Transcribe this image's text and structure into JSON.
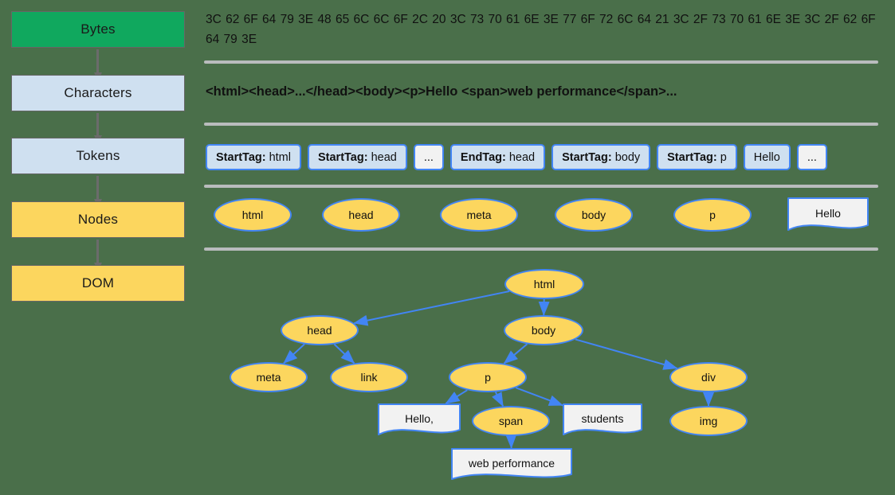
{
  "colors": {
    "background": "#4a6f4a",
    "green": "#10a85e",
    "light_blue": "#cfe0f0",
    "yellow": "#fcd65e",
    "node_border_blue": "#4285f4",
    "arrow_gray": "#6b6b6b",
    "separator_gray": "#b9bcbd",
    "text_node_gray": "#f2f2f2"
  },
  "pipeline": {
    "stages": [
      {
        "label": "Bytes",
        "style": "green"
      },
      {
        "label": "Characters",
        "style": "blue"
      },
      {
        "label": "Tokens",
        "style": "blue"
      },
      {
        "label": "Nodes",
        "style": "yellow"
      },
      {
        "label": "DOM",
        "style": "yellow"
      }
    ]
  },
  "bytes_row": {
    "text": "3C 62 6F 64 79 3E 48 65 6C 6C 6F 2C 20 3C 73 70 61 6E 3E 77 6F 72 6C 64 21 3C 2F 73 70 61 6E 3E 3C 2F 62 6F 64 79 3E"
  },
  "characters_row": {
    "text": "<html><head>...</head><body><p>Hello <span>web performance</span>..."
  },
  "tokens_row": {
    "tokens": [
      {
        "kind": "StartTag:",
        "value": "html",
        "plain": false
      },
      {
        "kind": "StartTag:",
        "value": "head",
        "plain": false
      },
      {
        "kind": "",
        "value": "...",
        "plain": true
      },
      {
        "kind": "EndTag:",
        "value": "head",
        "plain": false
      },
      {
        "kind": "StartTag:",
        "value": "body",
        "plain": false
      },
      {
        "kind": "StartTag:",
        "value": "p",
        "plain": false
      },
      {
        "kind": "",
        "value": "Hello",
        "plain": false
      },
      {
        "kind": "",
        "value": "...",
        "plain": true
      }
    ]
  },
  "nodes_row": {
    "nodes": [
      {
        "label": "html",
        "shape": "ellipse"
      },
      {
        "label": "head",
        "shape": "ellipse"
      },
      {
        "label": "meta",
        "shape": "ellipse"
      },
      {
        "label": "body",
        "shape": "ellipse"
      },
      {
        "label": "p",
        "shape": "ellipse"
      },
      {
        "label": "Hello",
        "shape": "document"
      }
    ]
  },
  "dom_tree": {
    "nodes": [
      {
        "id": "html",
        "label": "html",
        "shape": "ellipse"
      },
      {
        "id": "head",
        "label": "head",
        "shape": "ellipse"
      },
      {
        "id": "body",
        "label": "body",
        "shape": "ellipse"
      },
      {
        "id": "meta",
        "label": "meta",
        "shape": "ellipse"
      },
      {
        "id": "link",
        "label": "link",
        "shape": "ellipse"
      },
      {
        "id": "p",
        "label": "p",
        "shape": "ellipse"
      },
      {
        "id": "div",
        "label": "div",
        "shape": "ellipse"
      },
      {
        "id": "hello",
        "label": "Hello,",
        "shape": "document"
      },
      {
        "id": "span",
        "label": "span",
        "shape": "ellipse"
      },
      {
        "id": "stud",
        "label": "students",
        "shape": "document"
      },
      {
        "id": "img",
        "label": "img",
        "shape": "ellipse"
      },
      {
        "id": "webp",
        "label": "web performance",
        "shape": "document"
      }
    ],
    "edges": [
      {
        "from": "html",
        "to": "head"
      },
      {
        "from": "html",
        "to": "body"
      },
      {
        "from": "head",
        "to": "meta"
      },
      {
        "from": "head",
        "to": "link"
      },
      {
        "from": "body",
        "to": "p"
      },
      {
        "from": "body",
        "to": "div"
      },
      {
        "from": "p",
        "to": "hello"
      },
      {
        "from": "p",
        "to": "span"
      },
      {
        "from": "p",
        "to": "stud"
      },
      {
        "from": "span",
        "to": "webp"
      },
      {
        "from": "div",
        "to": "img"
      }
    ]
  }
}
